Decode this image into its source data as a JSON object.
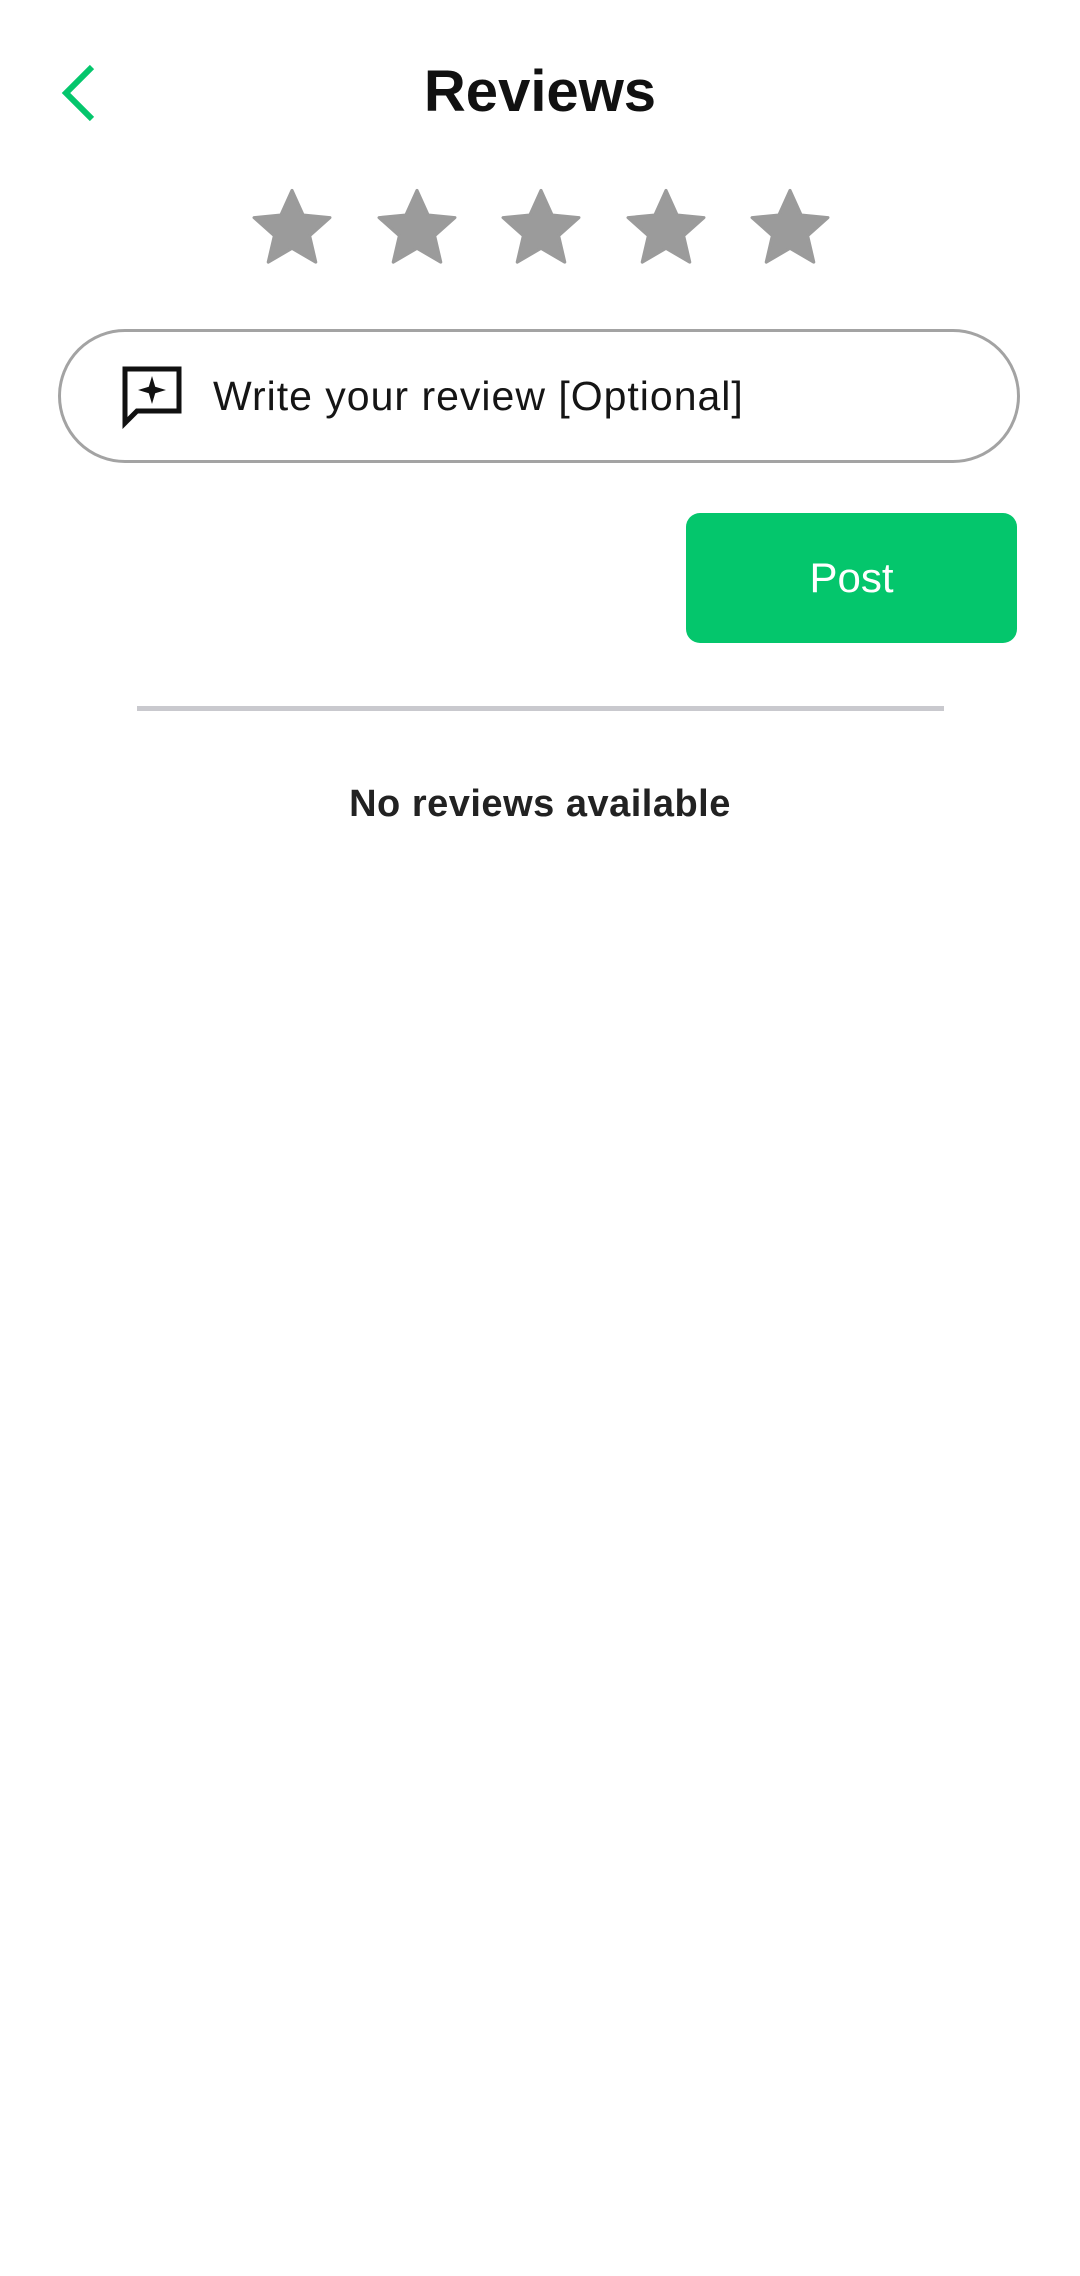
{
  "header": {
    "title": "Reviews",
    "back_icon": "chevron-left-icon"
  },
  "rating": {
    "max_stars": 5,
    "selected": 0,
    "star_icon": "star-icon"
  },
  "review_input": {
    "icon": "chat-sparkle-icon",
    "placeholder": "Write your review [Optional]"
  },
  "post_button": {
    "label": "Post"
  },
  "reviews": {
    "empty_message": "No reviews available"
  },
  "colors": {
    "accent": "#04c66c",
    "star_inactive": "#9b9b9b",
    "input_border": "#a3a3a3",
    "divider": "#c9c9ce"
  }
}
